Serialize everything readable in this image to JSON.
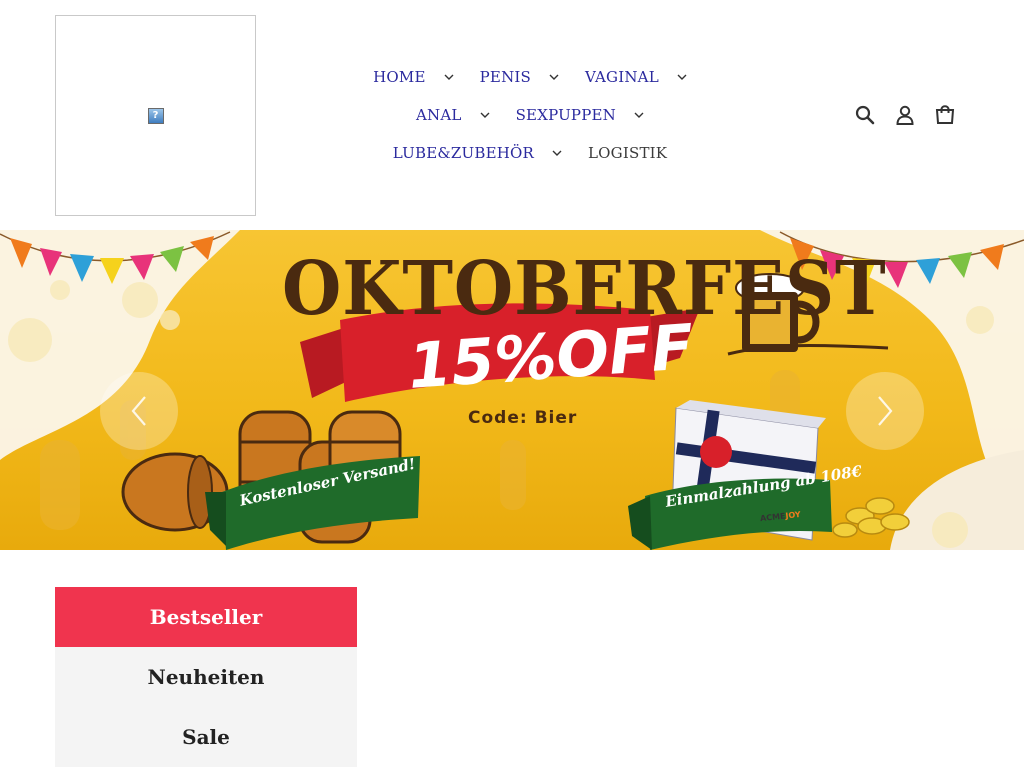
{
  "header": {
    "logo_glyph": "?",
    "nav_rows": [
      [
        {
          "label": "HOME",
          "has_dropdown": true
        },
        {
          "label": "PENIS",
          "has_dropdown": true
        },
        {
          "label": "VAGINAL",
          "has_dropdown": true
        }
      ],
      [
        {
          "label": "ANAL",
          "has_dropdown": true
        },
        {
          "label": "SEXPUPPEN",
          "has_dropdown": true
        }
      ],
      [
        {
          "label": "LUBE&ZUBEHÖR",
          "has_dropdown": true
        },
        {
          "label": "LOGISTIK",
          "has_dropdown": false
        }
      ]
    ],
    "icons": [
      "search-icon",
      "account-icon",
      "cart-icon"
    ]
  },
  "hero": {
    "title": "OKTOBERFEST",
    "discount": "15%OFF",
    "code": "Code: Bier",
    "ribbon_left": "Kostenloser Versand!",
    "ribbon_right": "Einmalzahlung ab 108€",
    "box_brand_a": "ACME",
    "box_brand_b": "JOY",
    "prev_icon": "chevron-left-icon",
    "next_icon": "chevron-right-icon"
  },
  "categories": {
    "tabs": [
      "Bestseller",
      "Neuheiten",
      "Sale"
    ],
    "active_index": 0
  },
  "colors": {
    "nav_link": "#2b2a9e",
    "active_tab": "#f0344e",
    "tab_bg": "#f4f4f4",
    "banner_yellow": "#f2b91a",
    "title_brown": "#4a2a10",
    "ribbon_red": "#d8202a",
    "ribbon_green": "#1f6b2a"
  }
}
